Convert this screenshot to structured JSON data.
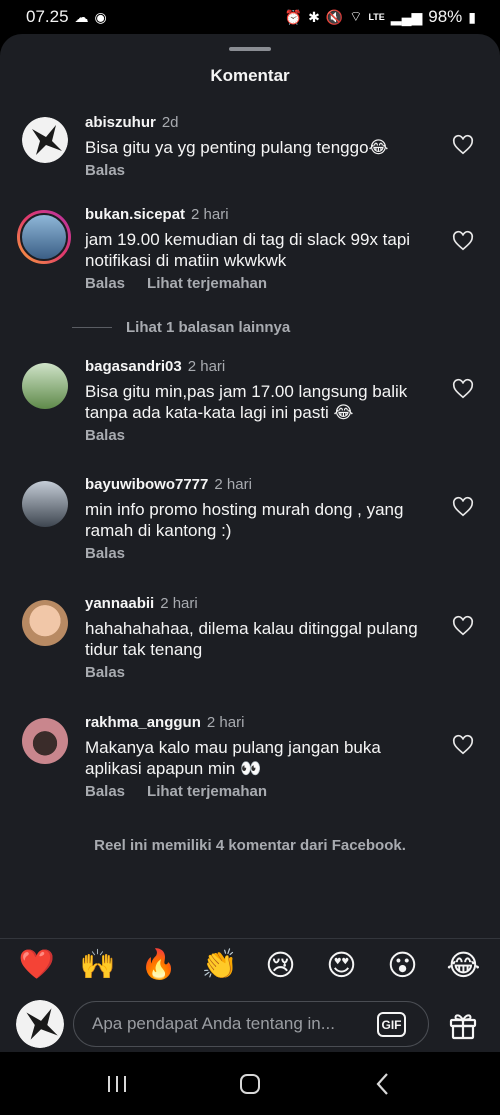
{
  "status": {
    "time": "07.25",
    "battery": "98%",
    "network": "LTE"
  },
  "sheet": {
    "title": "Komentar"
  },
  "comments": [
    {
      "user": "abiszuhur",
      "time": "2d",
      "text": "Bisa gitu ya yg penting pulang tenggo😂",
      "reply": "Balas",
      "translate": ""
    },
    {
      "user": "bukan.sicepat",
      "time": "2 hari",
      "text": "jam 19.00 kemudian di tag di slack 99x tapi notifikasi di matiin wkwkwk",
      "reply": "Balas",
      "translate": "Lihat terjemahan"
    },
    {
      "user": "bagasandri03",
      "time": "2 hari",
      "text": "Bisa gitu min,pas jam 17.00 langsung balik tanpa ada kata-kata lagi ini pasti 😂",
      "reply": "Balas",
      "translate": ""
    },
    {
      "user": "bayuwibowo7777",
      "time": "2 hari",
      "text": "min info promo hosting murah dong , yang ramah di kantong :)",
      "reply": "Balas",
      "translate": ""
    },
    {
      "user": "yannaabii",
      "time": "2 hari",
      "text": "hahahahahaa, dilema kalau ditinggal pulang tidur tak tenang",
      "reply": "Balas",
      "translate": ""
    },
    {
      "user": "rakhma_anggun",
      "time": "2 hari",
      "text": "Makanya kalo mau pulang jangan buka aplikasi apapun min 👀",
      "reply": "Balas",
      "translate": "Lihat terjemahan"
    }
  ],
  "more_replies": "Lihat 1 balasan lainnya",
  "facebook_note": "Reel ini memiliki 4 komentar dari Facebook.",
  "emojis": [
    "❤️",
    "🙌",
    "🔥",
    "👏",
    "😢",
    "😍",
    "😮",
    "😂"
  ],
  "input": {
    "placeholder": "Apa pendapat Anda tentang in...",
    "gif_label": "GIF"
  }
}
